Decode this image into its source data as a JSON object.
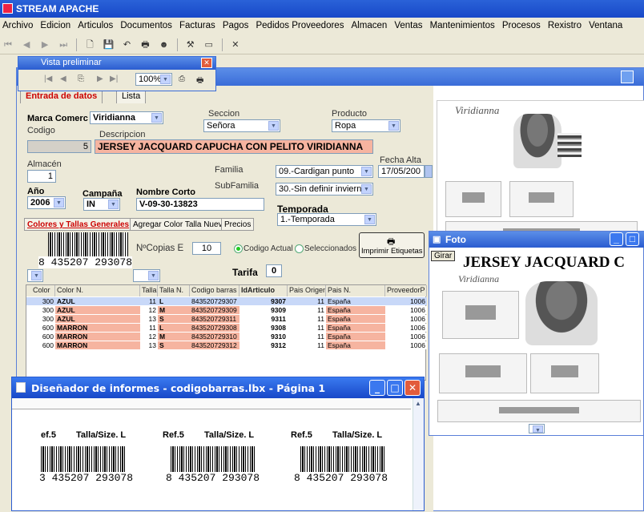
{
  "app": {
    "title": "STREAM APACHE"
  },
  "menu": [
    "Archivo",
    "Edicion",
    "Articulos",
    "Documentos",
    "Facturas",
    "Pagos",
    "Pedidos Proveedores",
    "Almacen",
    "Ventas",
    "Mantenimientos",
    "Procesos",
    "Rexistro",
    "Ventana"
  ],
  "vista": {
    "title": "Vista preliminar",
    "zoom": "100%"
  },
  "tabs": {
    "entrada": "Entrada de datos",
    "lista": "Lista"
  },
  "form": {
    "marca_label": "Marca Comerc",
    "marca_value": "Viridianna",
    "seccion_label": "Seccion",
    "seccion_value": "Señora",
    "producto_label": "Producto",
    "producto_value": "Ropa",
    "codigo_label": "Codigo",
    "codigo_value": "5",
    "descripcion_label": "Descripcion",
    "descripcion_value": "JERSEY JACQUARD CAPUCHA CON PELITO VIRIDIANNA",
    "almacen_label": "Almacén",
    "almacen_value": "1",
    "familia_label": "Familia",
    "familia_value": "09.-Cardigan punto",
    "subfamilia_label": "SubFamilia",
    "subfamilia_value": "30.-Sin definir inviern",
    "fecha_label": "Fecha Alta",
    "fecha_value": "17/05/200",
    "ano_label": "Año",
    "ano_value": "2006",
    "campana_label": "Campaña",
    "campana_value": "IN",
    "nombre_label": "Nombre Corto",
    "nombre_value": "V-09-30-13823",
    "temporada_label": "Temporada",
    "temporada_value": "1.-Temporada"
  },
  "subtabs": [
    "Colores y Tallas Generales",
    "Agregar Color Talla Nuevo",
    "Precios"
  ],
  "barcode_panel": {
    "number": "8 435207 293078",
    "ncopias_label": "NºCopias E",
    "ncopias_value": "10",
    "radio_actual": "Codigo Actual",
    "radio_selec": "Seleccionados",
    "print_btn": "Imprimir Etiquetas",
    "tarifa_label": "Tarifa",
    "tarifa_value": "0"
  },
  "grid": {
    "headers": [
      "Color",
      "Color N.",
      "Talla",
      "Talla N.",
      "Codigo barras",
      "IdArticulo",
      "Pais Origen",
      "Pais N.",
      "ProveedorP"
    ],
    "rows": [
      [
        "300",
        "AZUL",
        "11",
        "L",
        "843520729307",
        "9307",
        "11",
        "España",
        "1006"
      ],
      [
        "300",
        "AZUL",
        "12",
        "M",
        "843520729309",
        "9309",
        "11",
        "España",
        "1006"
      ],
      [
        "300",
        "AZUL",
        "13",
        "S",
        "843520729311",
        "9311",
        "11",
        "España",
        "1006"
      ],
      [
        "600",
        "MARRON",
        "11",
        "L",
        "843520729308",
        "9308",
        "11",
        "España",
        "1006"
      ],
      [
        "600",
        "MARRON",
        "12",
        "M",
        "843520729310",
        "9310",
        "11",
        "España",
        "1006"
      ],
      [
        "600",
        "MARRON",
        "13",
        "S",
        "843520729312",
        "9312",
        "11",
        "España",
        "1006"
      ]
    ]
  },
  "foto": {
    "title": "Foto",
    "girar": "Girar",
    "heading": "JERSEY JACQUARD C"
  },
  "sheet": {
    "brand": "Viridianna"
  },
  "disenador": {
    "title": "Diseñador de informes - codigobarras.lbx - Página 1",
    "labels": [
      {
        "ref": "ef.5",
        "talla": "Talla/Size. L",
        "number": "3 435207 293078"
      },
      {
        "ref": "Ref.5",
        "talla": "Talla/Size. L",
        "number": "8 435207 293078"
      },
      {
        "ref": "Ref.5",
        "talla": "Talla/Size. L",
        "number": "8 435207 293078"
      }
    ]
  }
}
